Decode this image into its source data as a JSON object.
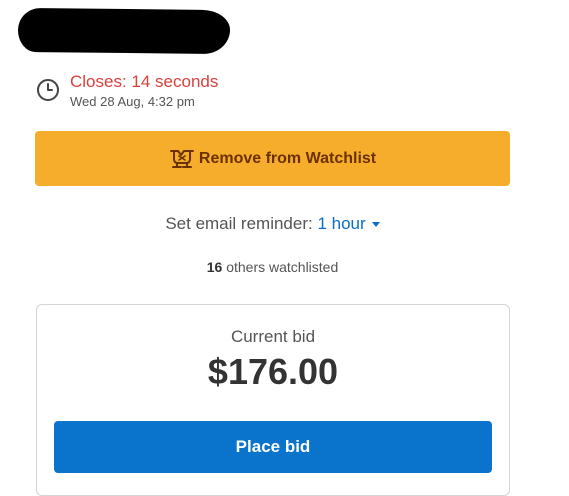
{
  "close": {
    "label": "Closes: 14 seconds",
    "date": "Wed 28 Aug, 4:32 pm"
  },
  "watchlist": {
    "button_label": "Remove from Watchlist"
  },
  "reminder": {
    "label": "Set email reminder:",
    "value": "1 hour"
  },
  "watchers": {
    "count": "16",
    "suffix": "others watchlisted"
  },
  "bid": {
    "label": "Current bid",
    "amount": "$176.00",
    "button_label": "Place bid"
  },
  "colors": {
    "close_red": "#d9413d",
    "watchlist_btn": "#f5ad2b",
    "watchlist_text": "#6b3100",
    "link_blue": "#0a6dc7",
    "primary_btn": "#0a73cc"
  },
  "icons": {
    "clock": "clock-icon",
    "watchlist": "watchlist-remove-icon",
    "dropdown": "caret-down-icon"
  }
}
